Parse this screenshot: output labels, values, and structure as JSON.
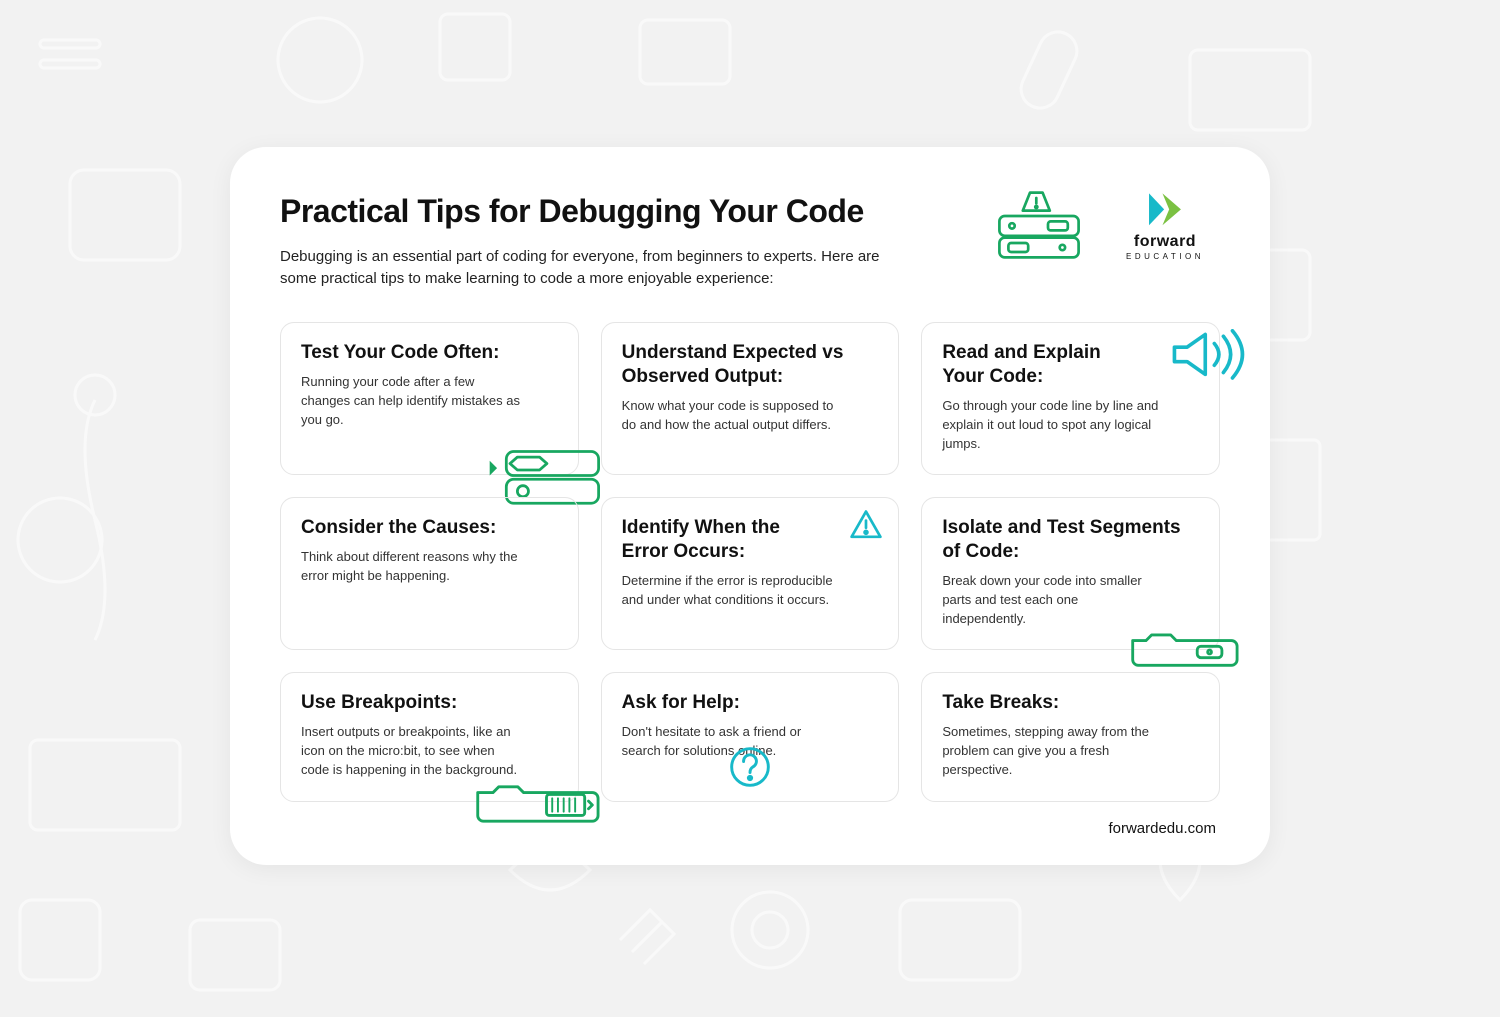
{
  "header": {
    "title": "Practical Tips for Debugging Your Code",
    "subtitle": "Debugging is an essential part of coding for everyone, from beginners to experts. Here are some practical tips to make learning to code a more enjoyable experience:"
  },
  "logo": {
    "name": "forward",
    "tag": "EDUCATION"
  },
  "tips": [
    {
      "title": "Test Your Code Often:",
      "body": "Running your code after a few changes can help identify mistakes as you go."
    },
    {
      "title": "Understand Expected vs Observed Output:",
      "body": "Know what your code is supposed to do and how the actual output differs."
    },
    {
      "title": "Read and Explain Your Code:",
      "body": "Go through your code line by line and explain it out loud to spot any logical jumps."
    },
    {
      "title": "Consider the Causes:",
      "body": "Think about different reasons why the error might be happening."
    },
    {
      "title": "Identify When the Error Occurs:",
      "body": "Determine if the error is reproducible and under what conditions it occurs."
    },
    {
      "title": "Isolate and Test Segments of Code:",
      "body": "Break down your code into smaller parts and test each one independently."
    },
    {
      "title": "Use Breakpoints:",
      "body": "Insert outputs or breakpoints, like an icon on the micro:bit, to see when code is happening in the background."
    },
    {
      "title": "Ask for Help:",
      "body": "Don't hesitate to ask a friend or search for solutions online."
    },
    {
      "title": "Take Breaks:",
      "body": "Sometimes, stepping away from the problem can give you a fresh perspective."
    }
  ],
  "footer": {
    "url": "forwardedu.com"
  },
  "colors": {
    "green": "#18a760",
    "teal": "#18b9c9",
    "dark": "#111111"
  }
}
